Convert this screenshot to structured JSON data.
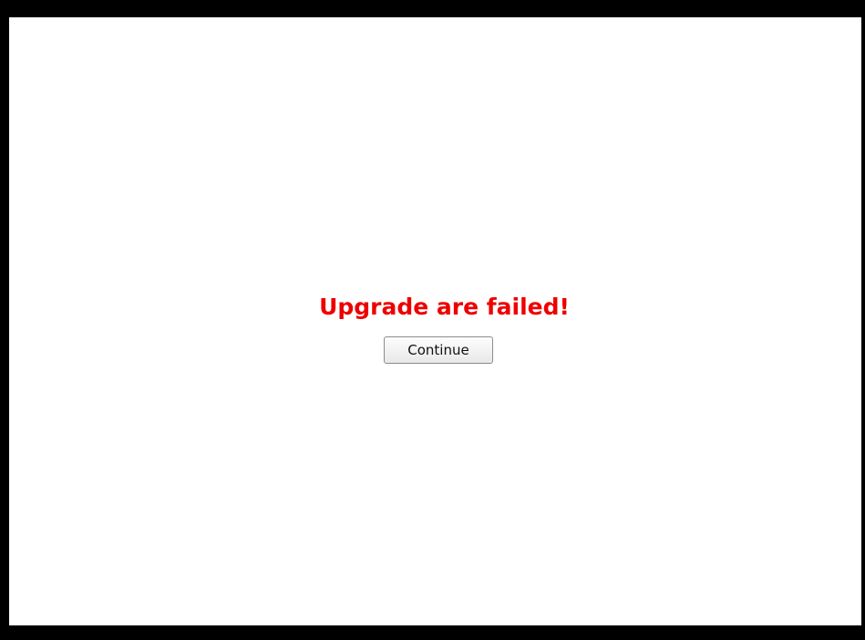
{
  "dialog": {
    "message": "Upgrade are failed!",
    "continue_label": "Continue"
  },
  "colors": {
    "message": "#ee0000",
    "frame": "#000000",
    "background": "#ffffff"
  }
}
